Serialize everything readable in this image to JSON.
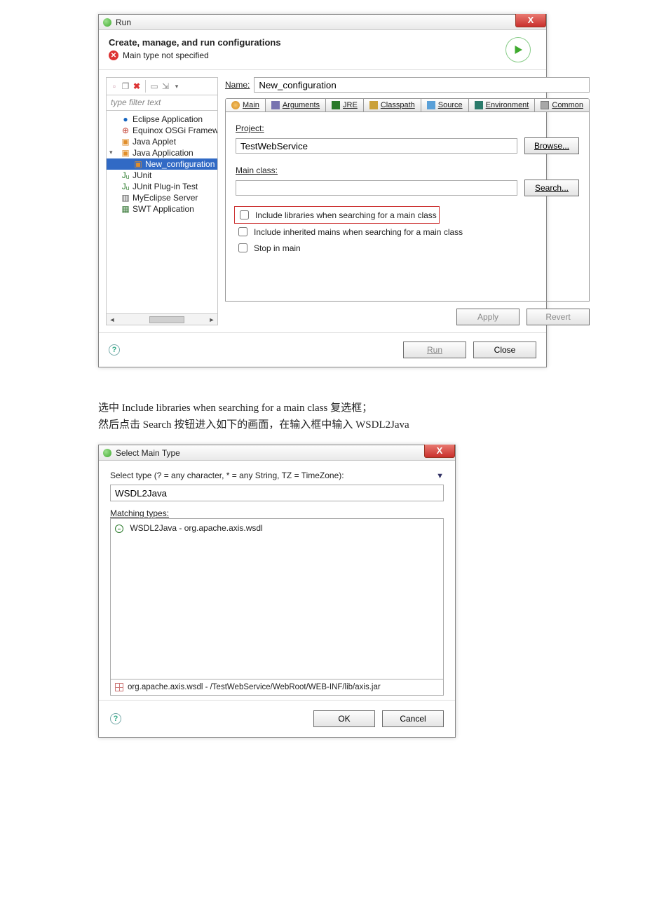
{
  "run": {
    "title": "Run",
    "close_x": "X",
    "header": "Create, manage, and run configurations",
    "error": "Main type not specified",
    "filter_placeholder": "type filter text",
    "tree": [
      {
        "label": "Eclipse Application",
        "glyph": "●",
        "color": "#1565c0"
      },
      {
        "label": "Equinox OSGi Framew",
        "glyph": "⊕",
        "color": "#c0392b"
      },
      {
        "label": "Java Applet",
        "glyph": "▣",
        "color": "#e08e2b"
      },
      {
        "label": "Java Application",
        "glyph": "▣",
        "color": "#e08e2b",
        "expandable": true,
        "expanded": true
      },
      {
        "label": "New_configuration",
        "glyph": "▣",
        "color": "#e08e2b",
        "child": true,
        "selected": true
      },
      {
        "label": "JUnit",
        "glyph": "Jᵤ",
        "color": "#2a7a2a"
      },
      {
        "label": "JUnit Plug-in Test",
        "glyph": "Jᵤ",
        "color": "#2a7a2a"
      },
      {
        "label": "MyEclipse Server",
        "glyph": "▥",
        "color": "#555"
      },
      {
        "label": "SWT Application",
        "glyph": "▦",
        "color": "#3a7a3a"
      }
    ],
    "name_label": "Name:",
    "name_value": "New_configuration",
    "tabs": [
      "Main",
      "Arguments",
      "JRE",
      "Classpath",
      "Source",
      "Environment",
      "Common"
    ],
    "project_label": "Project:",
    "project_value": "TestWebService",
    "browse": "Browse...",
    "mainclass_label": "Main class:",
    "mainclass_value": "",
    "search": "Search...",
    "chk1": "Include libraries when searching for a main class",
    "chk2": "Include inherited mains when searching for a main class",
    "chk3": "Stop in main",
    "apply": "Apply",
    "revert": "Revert",
    "run_btn": "Run",
    "close_btn": "Close"
  },
  "paragraph": {
    "line1": "选中 Include libraries when searching for a main class 复选框；",
    "line2": "然后点击 Search 按钮进入如下的画面，在输入框中输入 WSDL2Java"
  },
  "smt": {
    "title": "Select Main Type",
    "close_x": "X",
    "prompt": "Select type (? = any character, * = any String, TZ = TimeZone):",
    "input": "WSDL2Java",
    "matching": "Matching types:",
    "result": "WSDL2Java - org.apache.axis.wsdl",
    "status": "org.apache.axis.wsdl - /TestWebService/WebRoot/WEB-INF/lib/axis.jar",
    "ok": "OK",
    "cancel": "Cancel"
  }
}
